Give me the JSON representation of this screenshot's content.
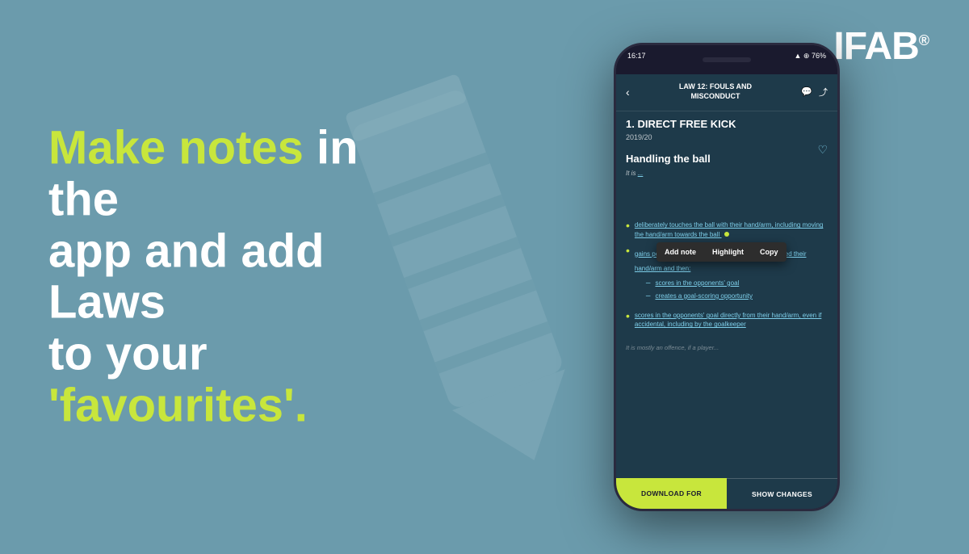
{
  "background": {
    "color": "#6b9bac"
  },
  "ifab_logo": {
    "text": "IFAB",
    "registered_mark": "®"
  },
  "hero": {
    "line1_normal": "in the",
    "line1_highlight": "Make notes",
    "line2": "app and add Laws",
    "line3_normal": "to your ",
    "line3_quote": "'favourites'."
  },
  "phone": {
    "status_bar": {
      "time": "16:17",
      "signal": "▲▲",
      "wifi": "WiFi",
      "battery": "76%"
    },
    "header": {
      "back_icon": "‹",
      "title_line1": "LAW 12: FOULS AND",
      "title_line2": "MISCONDUCT",
      "comment_icon": "💬",
      "share_icon": "⤴"
    },
    "section_title": "1. DIRECT FREE KICK",
    "year": "2019/20",
    "handling_title": "Handling the ball",
    "partial_text": "It is ...",
    "context_menu": {
      "items": [
        "Add note",
        "Highlight",
        "Copy"
      ]
    },
    "list_items": [
      {
        "text": "deliberately touches the ball with their hand/arm, including moving the hand/arm towards the ball",
        "type": "bullet"
      },
      {
        "text": "gains possession/control of the ball after it has touched their hand/arm and then:",
        "type": "bullet",
        "sub_items": [
          "scores in the opponents' goal",
          "creates a goal-scoring opportunity"
        ]
      },
      {
        "text": "scores in the opponents' goal directly from their hand/arm, even if accidental, including by the goalkeeper",
        "type": "bullet"
      }
    ],
    "faded_text": "It is mostly an offence, if a player...",
    "bottom_buttons": {
      "download": "DOWNLOAD FOR",
      "show_changes": "SHOW CHANGES"
    }
  }
}
